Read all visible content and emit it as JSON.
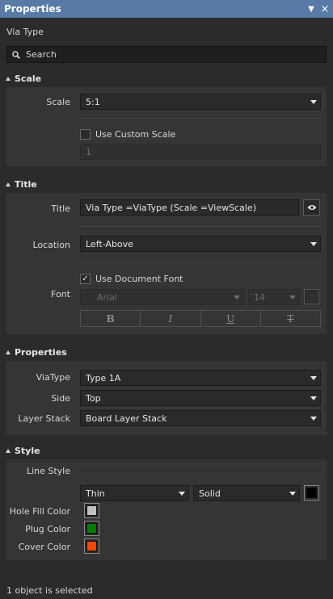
{
  "window": {
    "title": "Properties",
    "pin_icon": "pin-icon",
    "close_icon": "close-icon"
  },
  "subtitle": "Via Type",
  "search": {
    "placeholder": "Search"
  },
  "scale": {
    "header": "Scale",
    "scale_label": "Scale",
    "scale_value": "5:1",
    "use_custom_label": "Use Custom Scale",
    "use_custom_checked": false,
    "custom_value": "1"
  },
  "title": {
    "header": "Title",
    "title_label": "Title",
    "title_value": "Via Type =ViaType (Scale =ViewScale)",
    "location_label": "Location",
    "location_value": "Left-Above",
    "font_label": "Font",
    "use_document_font_label": "Use Document Font",
    "use_document_font_checked": true,
    "font_family": "Arial",
    "font_size": "14",
    "bold": "B",
    "italic": "I",
    "underline": "U",
    "strike": "T"
  },
  "properties": {
    "header": "Properties",
    "viatype_label": "ViaType",
    "viatype_value": "Type 1A",
    "side_label": "Side",
    "side_value": "Top",
    "layer_stack_label": "Layer Stack",
    "layer_stack_value": "Board Layer Stack"
  },
  "style": {
    "header": "Style",
    "line_style_label": "Line Style",
    "line_weight": "Thin",
    "line_type": "Solid",
    "line_color": "#000000",
    "hole_fill_label": "Hole Fill Color",
    "hole_fill_color": "#c0c0c0",
    "plug_label": "Plug Color",
    "plug_color": "#008000",
    "cover_label": "Cover Color",
    "cover_color": "#ff4500"
  },
  "status": "1 object is selected"
}
